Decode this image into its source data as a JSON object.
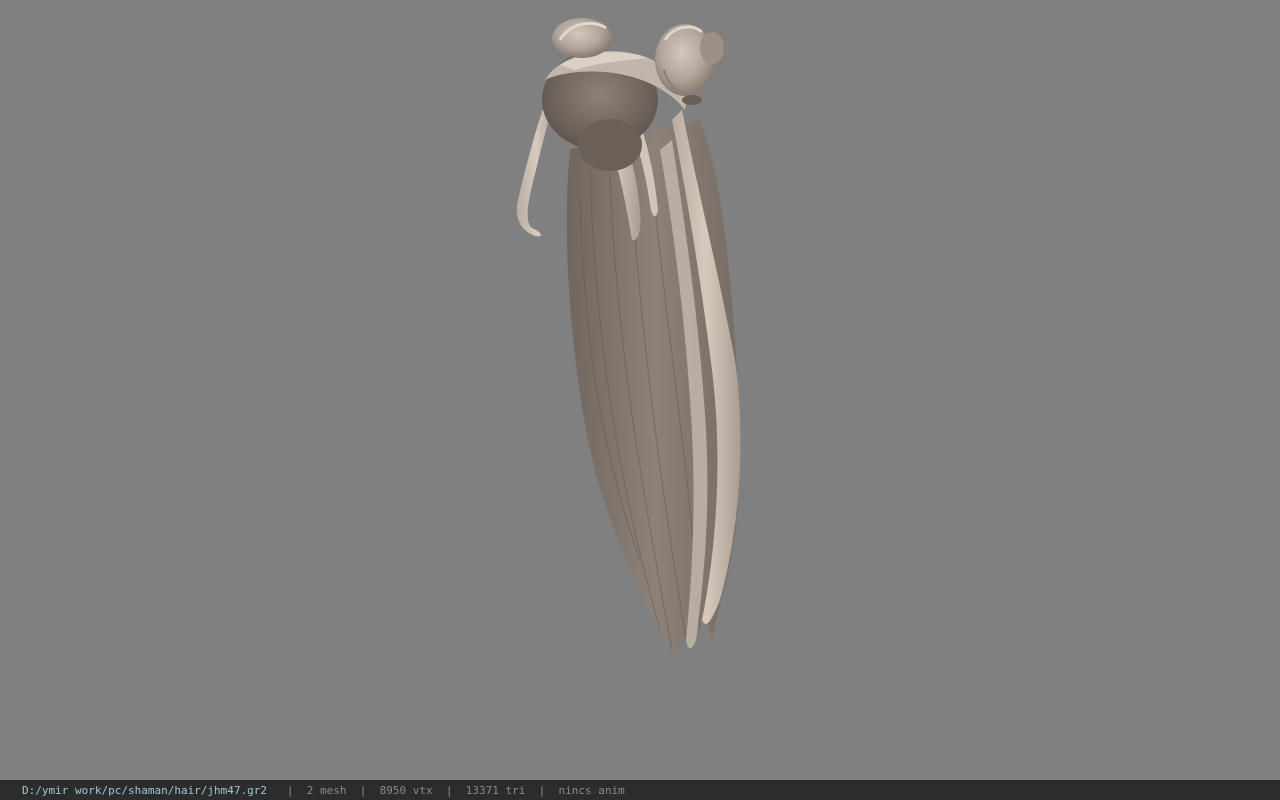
{
  "viewport": {
    "background_color": "#808080",
    "model_icon": "hair-mesh-icon",
    "hair_colors": {
      "light": "#cdbfb2",
      "mid": "#a89c92",
      "dark": "#6e645d"
    }
  },
  "statusbar": {
    "file_path": "D:/ymir work/pc/shaman/hair/jhm47.gr2",
    "separator": "|",
    "mesh_count": "2 mesh",
    "vertex_count": "8950 vtx",
    "triangle_count": "13371 tri",
    "anim_status": "nincs anim",
    "background_color": "#2c2c2c",
    "path_color": "#9fc7d6"
  }
}
